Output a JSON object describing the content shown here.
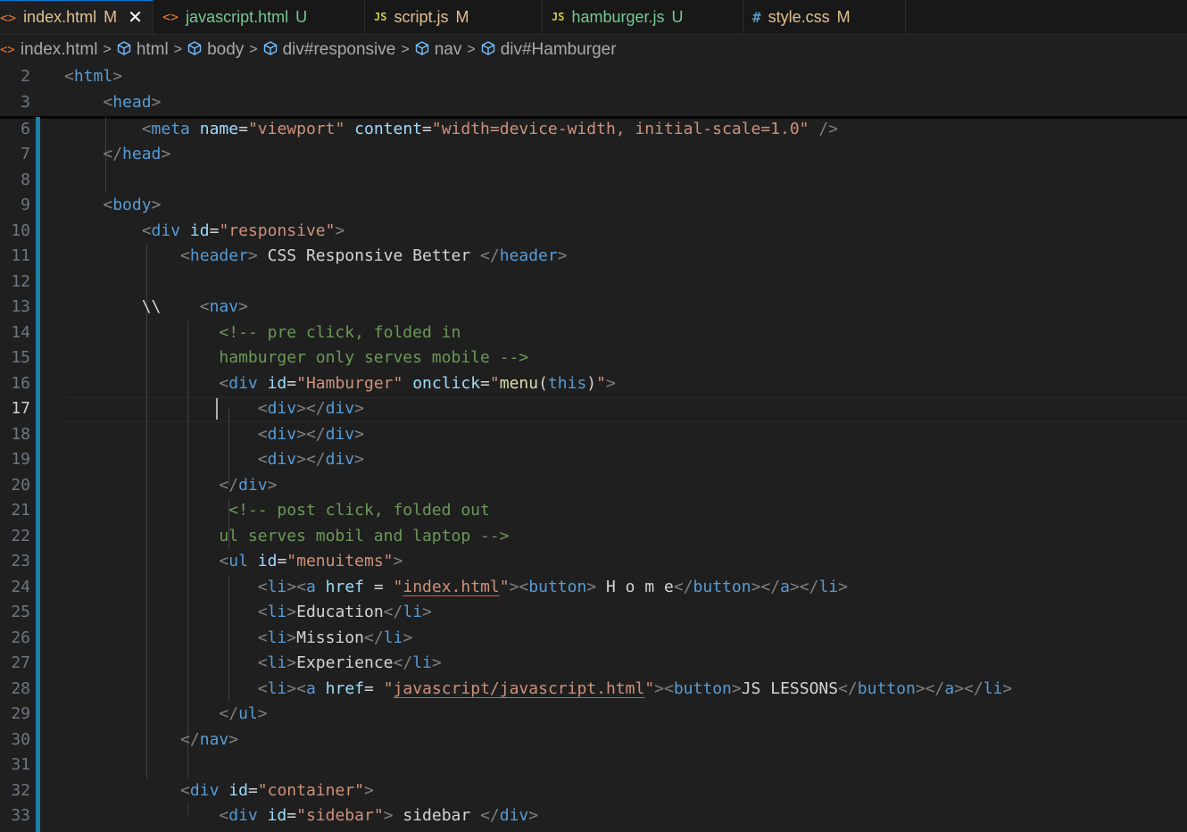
{
  "tabs": [
    {
      "icon": "<>",
      "icon_type": "html",
      "label": "index.html",
      "status": "M",
      "active": true
    },
    {
      "icon": "<>",
      "icon_type": "html",
      "label": "javascript.html",
      "status": "U",
      "active": false
    },
    {
      "icon": "JS",
      "icon_type": "js",
      "label": "script.js",
      "status": "M",
      "active": false
    },
    {
      "icon": "JS",
      "icon_type": "js",
      "label": "hamburger.js",
      "status": "U",
      "active": false
    },
    {
      "icon": "#",
      "icon_type": "css",
      "label": "style.css",
      "status": "M",
      "active": false
    }
  ],
  "close_glyph": "✕",
  "breadcrumb": {
    "file_icon": "<>",
    "items": [
      "index.html",
      "html",
      "body",
      "div#responsive",
      "nav",
      "div#Hamburger"
    ],
    "separator": ">"
  },
  "editor": {
    "current_line": "17",
    "lines": [
      {
        "n": "2",
        "tokens": [
          [
            "p",
            "<"
          ],
          [
            "t",
            "html"
          ],
          [
            "p",
            ">"
          ]
        ]
      },
      {
        "n": "3",
        "tokens": [
          [
            "x",
            "    "
          ],
          [
            "p",
            "<"
          ],
          [
            "t",
            "head"
          ],
          [
            "p",
            ">"
          ]
        ]
      },
      {
        "n": "6",
        "tokens": [
          [
            "x",
            "        "
          ],
          [
            "p",
            "<"
          ],
          [
            "t",
            "meta"
          ],
          [
            "x",
            " "
          ],
          [
            "a",
            "name"
          ],
          [
            "x",
            "="
          ],
          [
            "s",
            "\"viewport\""
          ],
          [
            "x",
            " "
          ],
          [
            "a",
            "content"
          ],
          [
            "x",
            "="
          ],
          [
            "s",
            "\"width=device-width, initial-scale=1.0\""
          ],
          [
            "x",
            " "
          ],
          [
            "p",
            "/>"
          ]
        ]
      },
      {
        "n": "7",
        "tokens": [
          [
            "x",
            "    "
          ],
          [
            "p",
            "</"
          ],
          [
            "t",
            "head"
          ],
          [
            "p",
            ">"
          ]
        ]
      },
      {
        "n": "8",
        "tokens": []
      },
      {
        "n": "9",
        "tokens": [
          [
            "x",
            "    "
          ],
          [
            "p",
            "<"
          ],
          [
            "t",
            "body"
          ],
          [
            "p",
            ">"
          ]
        ]
      },
      {
        "n": "10",
        "tokens": [
          [
            "x",
            "        "
          ],
          [
            "p",
            "<"
          ],
          [
            "t",
            "div"
          ],
          [
            "x",
            " "
          ],
          [
            "a",
            "id"
          ],
          [
            "x",
            "="
          ],
          [
            "s",
            "\"responsive\""
          ],
          [
            "p",
            ">"
          ]
        ]
      },
      {
        "n": "11",
        "tokens": [
          [
            "x",
            "            "
          ],
          [
            "p",
            "<"
          ],
          [
            "t",
            "header"
          ],
          [
            "p",
            ">"
          ],
          [
            "x",
            " CSS Responsive Better "
          ],
          [
            "p",
            "</"
          ],
          [
            "t",
            "header"
          ],
          [
            "p",
            ">"
          ]
        ]
      },
      {
        "n": "12",
        "tokens": []
      },
      {
        "n": "13",
        "tokens": [
          [
            "x",
            "        \\\\    "
          ],
          [
            "p",
            "<"
          ],
          [
            "t",
            "nav"
          ],
          [
            "p",
            ">"
          ]
        ]
      },
      {
        "n": "14",
        "tokens": [
          [
            "x",
            "                "
          ],
          [
            "c",
            "<!-- pre click, folded in"
          ]
        ]
      },
      {
        "n": "15",
        "tokens": [
          [
            "x",
            "                "
          ],
          [
            "c",
            "hamburger only serves mobile -->"
          ]
        ]
      },
      {
        "n": "16",
        "tokens": [
          [
            "x",
            "                "
          ],
          [
            "p",
            "<"
          ],
          [
            "t",
            "div"
          ],
          [
            "x",
            " "
          ],
          [
            "a",
            "id"
          ],
          [
            "x",
            "="
          ],
          [
            "s",
            "\"Hamburger\""
          ],
          [
            "x",
            " "
          ],
          [
            "a",
            "onclick"
          ],
          [
            "x",
            "="
          ],
          [
            "s",
            "\""
          ],
          [
            "f",
            "menu"
          ],
          [
            "x",
            "("
          ],
          [
            "k",
            "this"
          ],
          [
            "x",
            ")"
          ],
          [
            "s",
            "\""
          ],
          [
            "p",
            ">"
          ]
        ]
      },
      {
        "n": "17",
        "tokens": [
          [
            "x",
            "                    "
          ],
          [
            "p",
            "<"
          ],
          [
            "t",
            "div"
          ],
          [
            "p",
            "></"
          ],
          [
            "t",
            "div"
          ],
          [
            "p",
            ">"
          ]
        ]
      },
      {
        "n": "18",
        "tokens": [
          [
            "x",
            "                    "
          ],
          [
            "p",
            "<"
          ],
          [
            "t",
            "div"
          ],
          [
            "p",
            "></"
          ],
          [
            "t",
            "div"
          ],
          [
            "p",
            ">"
          ]
        ]
      },
      {
        "n": "19",
        "tokens": [
          [
            "x",
            "                    "
          ],
          [
            "p",
            "<"
          ],
          [
            "t",
            "div"
          ],
          [
            "p",
            "></"
          ],
          [
            "t",
            "div"
          ],
          [
            "p",
            ">"
          ]
        ]
      },
      {
        "n": "20",
        "tokens": [
          [
            "x",
            "                "
          ],
          [
            "p",
            "</"
          ],
          [
            "t",
            "div"
          ],
          [
            "p",
            ">"
          ]
        ]
      },
      {
        "n": "21",
        "tokens": [
          [
            "x",
            "                 "
          ],
          [
            "c",
            "<!-- post click, folded out"
          ]
        ]
      },
      {
        "n": "22",
        "tokens": [
          [
            "x",
            "                "
          ],
          [
            "c",
            "ul serves mobil and laptop -->"
          ]
        ]
      },
      {
        "n": "23",
        "tokens": [
          [
            "x",
            "                "
          ],
          [
            "p",
            "<"
          ],
          [
            "t",
            "ul"
          ],
          [
            "x",
            " "
          ],
          [
            "a",
            "id"
          ],
          [
            "x",
            "="
          ],
          [
            "s",
            "\"menuitems\""
          ],
          [
            "p",
            ">"
          ]
        ]
      },
      {
        "n": "24",
        "tokens": [
          [
            "x",
            "                    "
          ],
          [
            "p",
            "<"
          ],
          [
            "t",
            "li"
          ],
          [
            "p",
            "><"
          ],
          [
            "t",
            "a"
          ],
          [
            "x",
            " "
          ],
          [
            "a",
            "href"
          ],
          [
            "x",
            " = "
          ],
          [
            "s",
            "\""
          ],
          [
            "su",
            "index.html"
          ],
          [
            "s",
            "\""
          ],
          [
            "p",
            "><"
          ],
          [
            "t",
            "button"
          ],
          [
            "p",
            ">"
          ],
          [
            "x",
            " H o m e"
          ],
          [
            "p",
            "</"
          ],
          [
            "t",
            "button"
          ],
          [
            "p",
            "></"
          ],
          [
            "t",
            "a"
          ],
          [
            "p",
            "></"
          ],
          [
            "t",
            "li"
          ],
          [
            "p",
            ">"
          ]
        ]
      },
      {
        "n": "25",
        "tokens": [
          [
            "x",
            "                    "
          ],
          [
            "p",
            "<"
          ],
          [
            "t",
            "li"
          ],
          [
            "p",
            ">"
          ],
          [
            "x",
            "Education"
          ],
          [
            "p",
            "</"
          ],
          [
            "t",
            "li"
          ],
          [
            "p",
            ">"
          ]
        ]
      },
      {
        "n": "26",
        "tokens": [
          [
            "x",
            "                    "
          ],
          [
            "p",
            "<"
          ],
          [
            "t",
            "li"
          ],
          [
            "p",
            ">"
          ],
          [
            "x",
            "Mission"
          ],
          [
            "p",
            "</"
          ],
          [
            "t",
            "li"
          ],
          [
            "p",
            ">"
          ]
        ]
      },
      {
        "n": "27",
        "tokens": [
          [
            "x",
            "                    "
          ],
          [
            "p",
            "<"
          ],
          [
            "t",
            "li"
          ],
          [
            "p",
            ">"
          ],
          [
            "x",
            "Experience"
          ],
          [
            "p",
            "</"
          ],
          [
            "t",
            "li"
          ],
          [
            "p",
            ">"
          ]
        ]
      },
      {
        "n": "28",
        "tokens": [
          [
            "x",
            "                    "
          ],
          [
            "p",
            "<"
          ],
          [
            "t",
            "li"
          ],
          [
            "p",
            "><"
          ],
          [
            "t",
            "a"
          ],
          [
            "x",
            " "
          ],
          [
            "a",
            "href"
          ],
          [
            "x",
            "= "
          ],
          [
            "s",
            "\""
          ],
          [
            "su",
            "javascript/javascript.html"
          ],
          [
            "s",
            "\""
          ],
          [
            "p",
            "><"
          ],
          [
            "t",
            "button"
          ],
          [
            "p",
            ">"
          ],
          [
            "x",
            "JS LESSONS"
          ],
          [
            "p",
            "</"
          ],
          [
            "t",
            "button"
          ],
          [
            "p",
            "></"
          ],
          [
            "t",
            "a"
          ],
          [
            "p",
            "></"
          ],
          [
            "t",
            "li"
          ],
          [
            "p",
            ">"
          ]
        ]
      },
      {
        "n": "29",
        "tokens": [
          [
            "x",
            "                "
          ],
          [
            "p",
            "</"
          ],
          [
            "t",
            "ul"
          ],
          [
            "p",
            ">"
          ]
        ]
      },
      {
        "n": "30",
        "tokens": [
          [
            "x",
            "            "
          ],
          [
            "p",
            "</"
          ],
          [
            "t",
            "nav"
          ],
          [
            "p",
            ">"
          ]
        ]
      },
      {
        "n": "31",
        "tokens": []
      },
      {
        "n": "32",
        "tokens": [
          [
            "x",
            "            "
          ],
          [
            "p",
            "<"
          ],
          [
            "t",
            "div"
          ],
          [
            "x",
            " "
          ],
          [
            "a",
            "id"
          ],
          [
            "x",
            "="
          ],
          [
            "s",
            "\"container\""
          ],
          [
            "p",
            ">"
          ]
        ]
      },
      {
        "n": "33",
        "tokens": [
          [
            "x",
            "                "
          ],
          [
            "p",
            "<"
          ],
          [
            "t",
            "div"
          ],
          [
            "x",
            " "
          ],
          [
            "a",
            "id"
          ],
          [
            "x",
            "="
          ],
          [
            "s",
            "\"sidebar\""
          ],
          [
            "p",
            ">"
          ],
          [
            "x",
            " sidebar "
          ],
          [
            "p",
            "</"
          ],
          [
            "t",
            "div"
          ],
          [
            "p",
            ">"
          ]
        ]
      }
    ]
  }
}
